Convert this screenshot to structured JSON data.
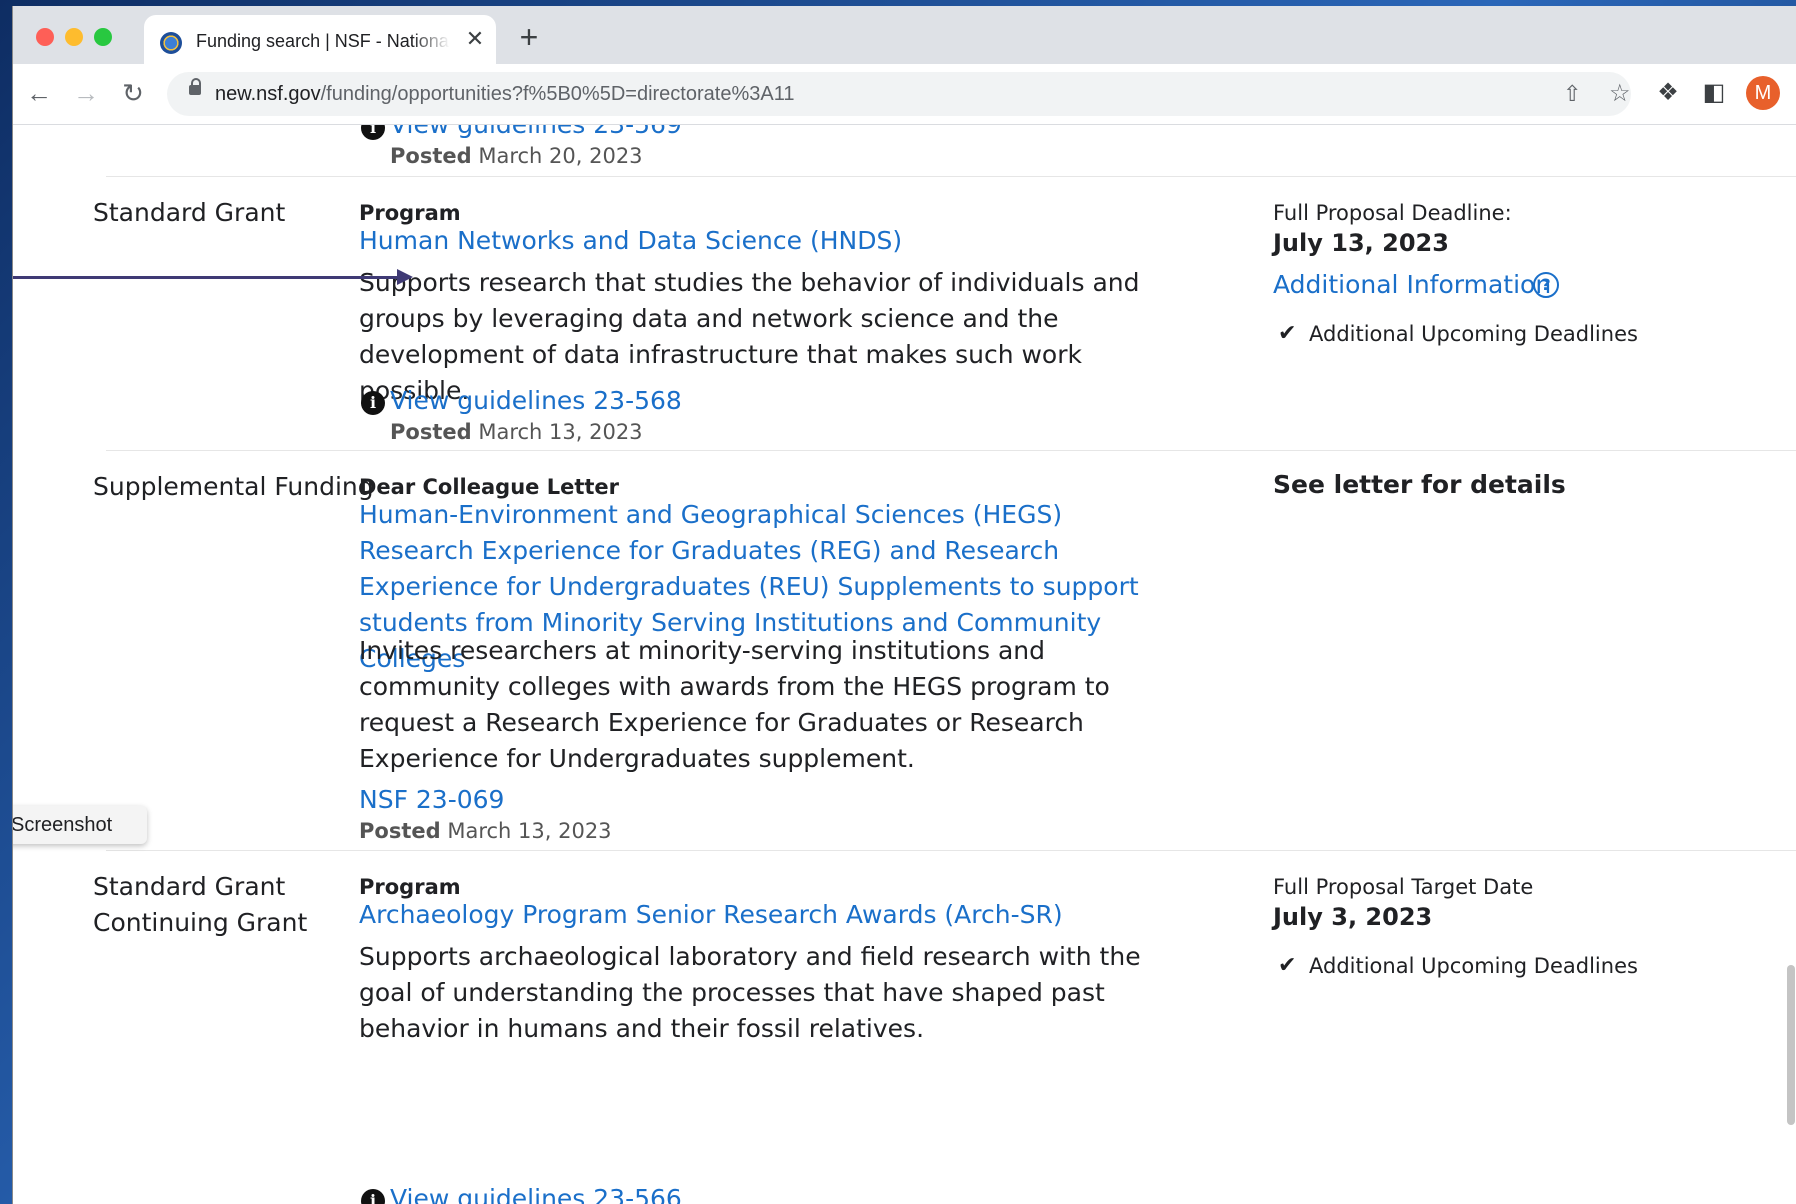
{
  "browser": {
    "tab_title": "Funding search | NSF - National Science Foundation",
    "tab_close": "✕",
    "new_tab": "+",
    "url_host": "new.nsf.gov",
    "url_path": "/funding/opportunities?f%5B0%5D=directorate%3A11",
    "avatar_letter": "M"
  },
  "listing": {
    "top_partial": {
      "guideline_link": "View guidelines 23-569",
      "posted_label": "Posted",
      "posted_date": "March 20, 2023"
    },
    "items": [
      {
        "types": [
          "Standard Grant"
        ],
        "kind": "Program",
        "title": "Human Networks and Data Science (HNDS)",
        "description": "Supports research that studies the behavior of individuals and groups by leveraging data and network science and the development of data infrastructure that makes such work possible.",
        "guideline_link": "View guidelines 23-568",
        "posted_label": "Posted",
        "posted_date": "March 13, 2023",
        "deadline_label": "Full Proposal Deadline:",
        "deadline_date": "July 13, 2023",
        "additional_info": "Additional Information",
        "upcoming": "Additional Upcoming Deadlines"
      },
      {
        "types": [
          "Supplemental Funding"
        ],
        "kind": "Dear Colleague Letter",
        "title": "Human-Environment and Geographical Sciences (HEGS) Research Experience for Graduates (REG) and Research Experience for Undergraduates (REU) Supplements to support students from Minority Serving Institutions and Community Colleges",
        "description": "Invites researchers at minority-serving institutions and community colleges with awards from the HEGS program to request a Research Experience for Graduates or Research Experience for Undergraduates supplement.",
        "guideline_link": "NSF 23-069",
        "posted_label": "Posted",
        "posted_date": "March 13, 2023",
        "deadline_note": "See letter for details"
      },
      {
        "types": [
          "Standard Grant",
          "Continuing Grant"
        ],
        "kind": "Program",
        "title": "Archaeology Program Senior Research Awards (Arch-SR)",
        "description": "Supports archaeological laboratory and field research with the goal of understanding the processes that have shaped past behavior in humans and their fossil relatives.",
        "guideline_link": "View guidelines 23-566",
        "deadline_label": "Full Proposal Target Date",
        "deadline_date": "July 3, 2023",
        "upcoming": "Additional Upcoming Deadlines"
      }
    ]
  },
  "overlay": {
    "screenshot_label": "Screenshot"
  }
}
